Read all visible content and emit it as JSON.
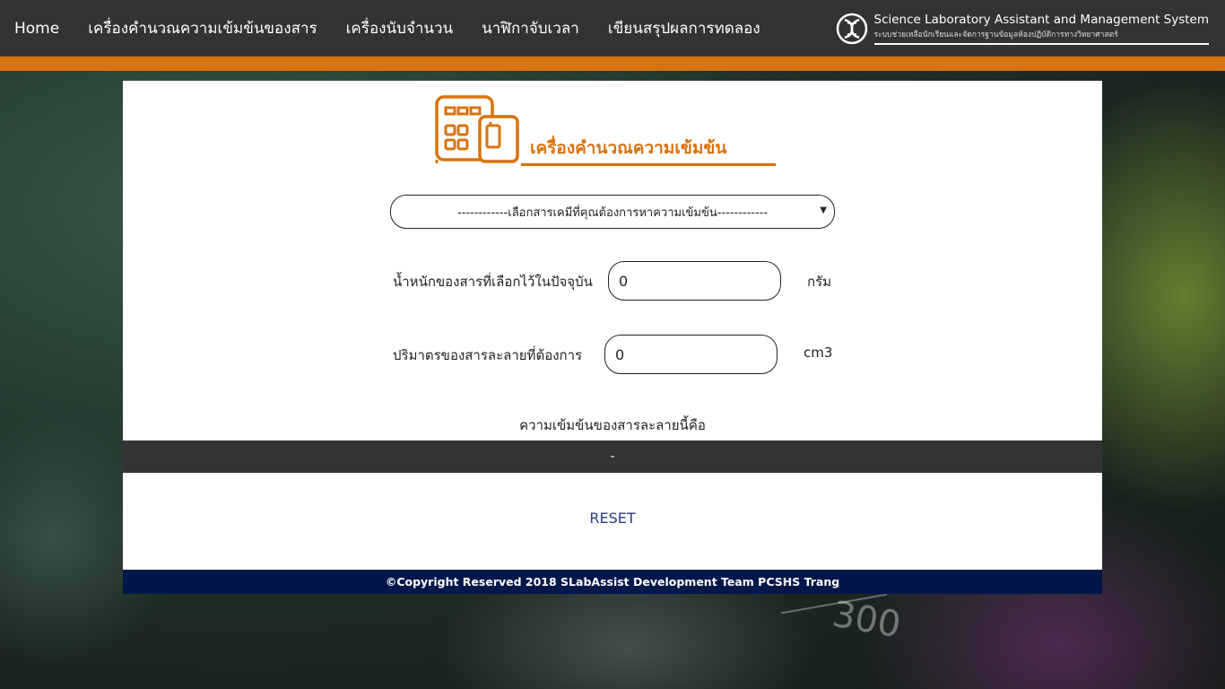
{
  "nav": {
    "items": [
      {
        "label": "Home"
      },
      {
        "label": "เครื่องคำนวณความเข้มข้นของสาร"
      },
      {
        "label": "เครื่องนับจำนวน"
      },
      {
        "label": "นาฬิกาจับเวลา"
      },
      {
        "label": "เขียนสรุปผลการทดลอง"
      }
    ],
    "brand_title": "Science Laboratory Assistant and Management System",
    "brand_subtitle": "ระบบช่วยเหลือนักเรียนและจัดการฐานข้อมูลห้องปฏิบัติการทางวิทยาศาสตร์",
    "brand_icon": "dna-icon"
  },
  "colors": {
    "nav_bg": "#333333",
    "accent": "#d9730d",
    "footer_bg": "#00174a",
    "reset_text": "#2b3a8a"
  },
  "calculator": {
    "logo_icon": "calculator-icon",
    "title": "เครื่องคำนวณความเข้มข้น",
    "select_placeholder": "------------เลือกสารเคมีที่คุณต้องการหาความเข้มข้น------------",
    "weight_label": "น้ำหนักของสารที่เลือกไว้ในปัจจุบัน",
    "weight_value": "0",
    "weight_unit": "กรัม",
    "volume_label": "ปริมาตรของสารละลายที่ต้องการ",
    "volume_value": "0",
    "volume_unit": "cm3",
    "result_label": "ความเข้มข้นของสารละลายนี้คือ",
    "result_value": "-",
    "reset_label": "RESET"
  },
  "footer": {
    "text": "©Copyright Reserved 2018 SLabAssist Development Team PCSHS Trang"
  },
  "background": {
    "numeral": "300"
  }
}
